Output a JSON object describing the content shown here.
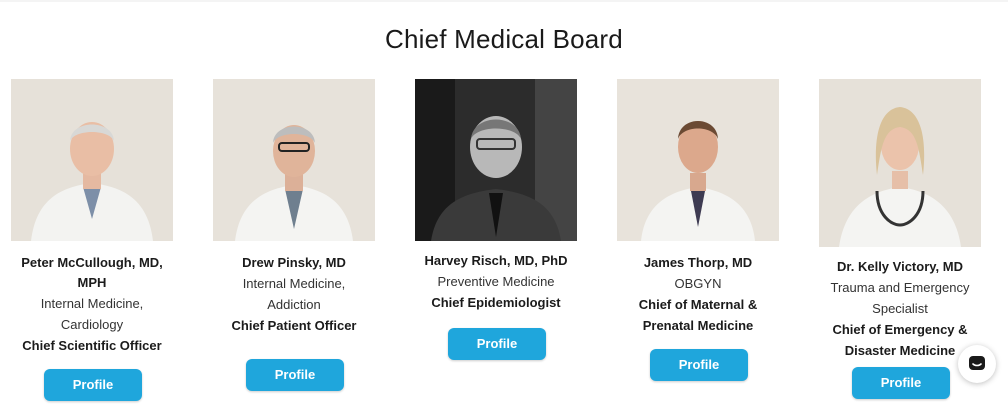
{
  "page_title": "Chief Medical Board",
  "members": [
    {
      "name": "Peter McCullough, MD, MPH",
      "specialty": "Internal Medicine, Cardiology",
      "role": "Chief Scientific Officer",
      "button": "Profile",
      "photo_style": "color"
    },
    {
      "name": "Drew Pinsky, MD",
      "specialty": "Internal Medicine, Addiction",
      "role": "Chief Patient Officer",
      "button": "Profile",
      "photo_style": "color"
    },
    {
      "name": "Harvey Risch, MD, PhD",
      "specialty": "Preventive Medicine",
      "role": "Chief Epidemiologist",
      "button": "Profile",
      "photo_style": "black-and-white"
    },
    {
      "name": "James Thorp, MD",
      "specialty": "OBGYN",
      "role": "Chief of Maternal & Prenatal Medicine",
      "button": "Profile",
      "photo_style": "color"
    },
    {
      "name": "Dr. Kelly Victory, MD",
      "specialty": "Trauma and Emergency Specialist",
      "role": "Chief of Emergency & Disaster Medicine",
      "button": "Profile",
      "photo_style": "color"
    }
  ],
  "chat_widget": {
    "icon": "chat-bubble-icon"
  },
  "colors": {
    "button": "#1fa6dc",
    "text": "#1b1b1b"
  }
}
